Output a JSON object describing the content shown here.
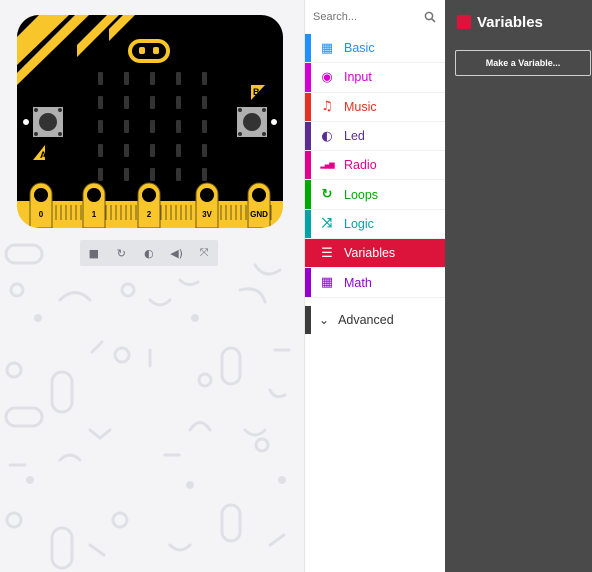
{
  "simulator": {
    "pins": [
      "0",
      "1",
      "2",
      "3V",
      "GND"
    ],
    "button_a": "A",
    "button_b": "B",
    "toolbar": [
      {
        "name": "stop-icon",
        "glyph": "■"
      },
      {
        "name": "restart-icon",
        "glyph": "↻"
      },
      {
        "name": "slow-motion-icon",
        "glyph": "◐"
      },
      {
        "name": "mute-icon",
        "glyph": "◀)"
      },
      {
        "name": "fullscreen-icon",
        "glyph": "⤧"
      }
    ]
  },
  "toolbox": {
    "search_placeholder": "Search...",
    "categories": [
      {
        "label": "Basic",
        "color": "#1e90ff",
        "icon": "grid-icon",
        "glyph": "▦"
      },
      {
        "label": "Input",
        "color": "#d400d4",
        "icon": "target-icon",
        "glyph": "◉"
      },
      {
        "label": "Music",
        "color": "#e63022",
        "icon": "headphones-icon",
        "glyph": "♫"
      },
      {
        "label": "Led",
        "color": "#5c2d91",
        "icon": "toggle-icon",
        "glyph": "◐"
      },
      {
        "label": "Radio",
        "color": "#e3008c",
        "icon": "signal-icon",
        "glyph": "▂▄▆"
      },
      {
        "label": "Loops",
        "color": "#00aa00",
        "icon": "loop-icon",
        "glyph": "↻"
      },
      {
        "label": "Logic",
        "color": "#00a4a6",
        "icon": "shuffle-icon",
        "glyph": "⤨"
      },
      {
        "label": "Variables",
        "color": "#dc143c",
        "icon": "list-icon",
        "glyph": "☰",
        "selected": true
      },
      {
        "label": "Math",
        "color": "#9400d3",
        "icon": "calculator-icon",
        "glyph": "▦"
      }
    ],
    "advanced_label": "Advanced",
    "advanced_color": "#3c3c3c"
  },
  "flyout": {
    "title": "Variables",
    "make_variable_label": "Make a Variable...",
    "background": "#4a4a4a"
  }
}
